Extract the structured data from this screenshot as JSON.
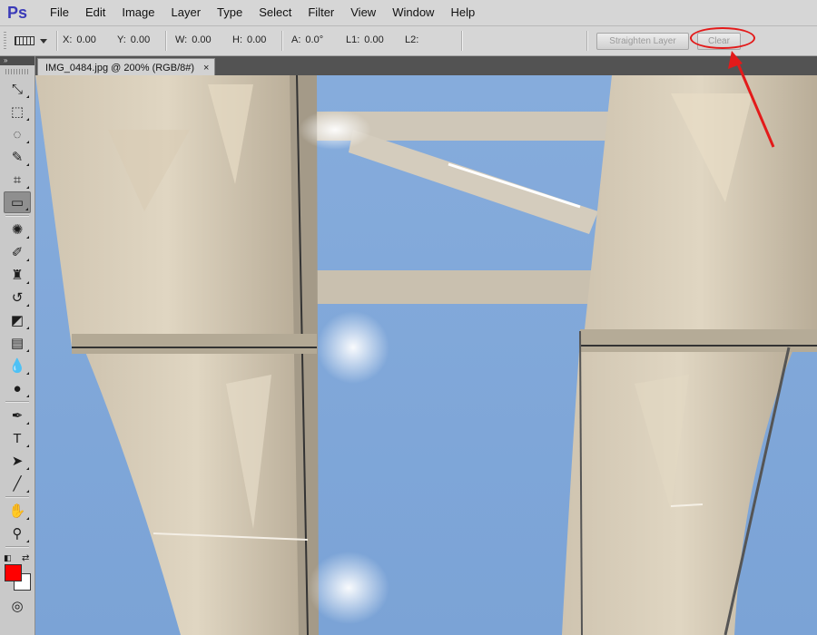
{
  "app": {
    "logo": "Ps"
  },
  "menu": [
    "File",
    "Edit",
    "Image",
    "Layer",
    "Type",
    "Select",
    "Filter",
    "View",
    "Window",
    "Help"
  ],
  "options": {
    "x": {
      "label": "X:",
      "value": "0.00"
    },
    "y": {
      "label": "Y:",
      "value": "0.00"
    },
    "w": {
      "label": "W:",
      "value": "0.00"
    },
    "h": {
      "label": "H:",
      "value": "0.00"
    },
    "a": {
      "label": "A:",
      "value": "0.0°"
    },
    "l1": {
      "label": "L1:",
      "value": "0.00"
    },
    "l2": {
      "label": "L2:",
      "value": ""
    },
    "straighten_label": "Straighten Layer",
    "clear_label": "Clear"
  },
  "toolbar_header": "»",
  "document_tab": {
    "title": "IMG_0484.jpg @ 200% (RGB/8#)",
    "close": "×"
  },
  "colors": {
    "foreground": "#ff0000",
    "background": "#ffffff",
    "annotation": "#e31a1a"
  },
  "tools": [
    {
      "name": "move-tool-icon",
      "glyph": "⤡"
    },
    {
      "name": "marquee-tool-icon",
      "glyph": "⬚"
    },
    {
      "name": "lasso-tool-icon",
      "glyph": "◌"
    },
    {
      "name": "quick-selection-tool-icon",
      "glyph": "✎"
    },
    {
      "name": "crop-tool-icon",
      "glyph": "⌗"
    },
    {
      "name": "ruler-tool-icon",
      "glyph": "▭",
      "active": true
    },
    {
      "name": "spot-healing-tool-icon",
      "glyph": "✺"
    },
    {
      "name": "brush-tool-icon",
      "glyph": "✐"
    },
    {
      "name": "clone-stamp-tool-icon",
      "glyph": "♜"
    },
    {
      "name": "history-brush-tool-icon",
      "glyph": "↺"
    },
    {
      "name": "eraser-tool-icon",
      "glyph": "◩"
    },
    {
      "name": "gradient-tool-icon",
      "glyph": "▤"
    },
    {
      "name": "blur-tool-icon",
      "glyph": "💧"
    },
    {
      "name": "dodge-tool-icon",
      "glyph": "●"
    },
    {
      "name": "pen-tool-icon",
      "glyph": "✒"
    },
    {
      "name": "type-tool-icon",
      "glyph": "T"
    },
    {
      "name": "path-selection-tool-icon",
      "glyph": "➤"
    },
    {
      "name": "line-tool-icon",
      "glyph": "╱"
    },
    {
      "name": "hand-tool-icon",
      "glyph": "✋"
    },
    {
      "name": "zoom-tool-icon",
      "glyph": "⚲"
    }
  ]
}
